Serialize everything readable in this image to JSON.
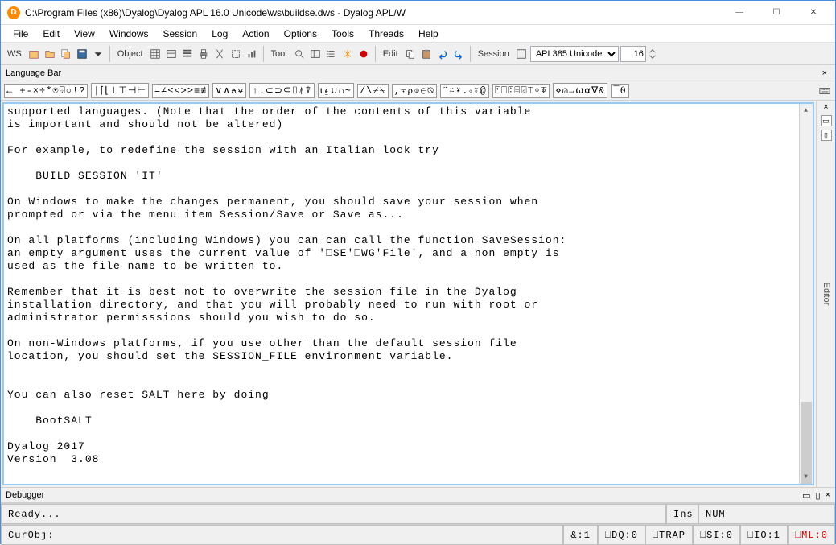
{
  "titlebar": {
    "icon_letter": "D",
    "path": "C:\\Program Files (x86)\\Dyalog\\Dyalog APL 16.0 Unicode\\ws\\buildse.dws - Dyalog APL/W"
  },
  "menu": [
    "File",
    "Edit",
    "View",
    "Windows",
    "Session",
    "Log",
    "Action",
    "Options",
    "Tools",
    "Threads",
    "Help"
  ],
  "toolbar": {
    "ws": "WS",
    "object": "Object",
    "tool": "Tool",
    "edit": "Edit",
    "session": "Session",
    "font_name": "APL385 Unicode",
    "font_size": "16"
  },
  "langbar_title": "Language Bar",
  "langbar_groups": [
    "← +-×÷*⍟⌹○!?",
    "|⌈⌊⊥⊤⊣⊢",
    "=≠≤<>≥≡≢",
    "∨∧⍲⍱",
    "↑↓⊂⊃⊆⌷⍋⍒",
    "⍳⍷∪∩~",
    "/\\⌿⍀",
    ",⍪⍴⌽⊖⍉",
    "¨⍨⍣.∘⍤@",
    "⍞⎕⍠⌸⌺⌶⍎⍕",
    "⋄⍝→⍵⍺∇&",
    "¯⍬"
  ],
  "session_text": "supported languages. (Note that the order of the contents of this variable\nis important and should not be altered)\n\nFor example, to redefine the session with an Italian look try\n\n    BUILD_SESSION 'IT'\n\nOn Windows to make the changes permanent, you should save your session when\nprompted or via the menu item Session/Save or Save as...\n\nOn all platforms (including Windows) you can can call the function SaveSession:\nan empty argument uses the current value of '⎕SE'⎕WG'File', and a non empty is\nused as the file name to be written to.\n\nRemember that it is best not to overwrite the session file in the Dyalog\ninstallation directory, and that you will probably need to run with root or\nadministrator permisssions should you wish to do so.\n\nOn non-Windows platforms, if you use other than the default session file\nlocation, you should set the SESSION_FILE environment variable.\n\n\nYou can also reset SALT here by doing\n\n    BootSALT\n\nDyalog 2017\nVersion  3.08",
  "side_label": "Editor",
  "debugger_title": "Debugger",
  "status1": {
    "ready": "Ready...",
    "ins": "Ins",
    "num": "NUM"
  },
  "status2": {
    "curobj": "CurObj:",
    "amp": "&:1",
    "dq": "⎕DQ:0",
    "trap": "⎕TRAP",
    "si": "⎕SI:0",
    "io": "⎕IO:1",
    "ml": "⎕ML:0"
  }
}
